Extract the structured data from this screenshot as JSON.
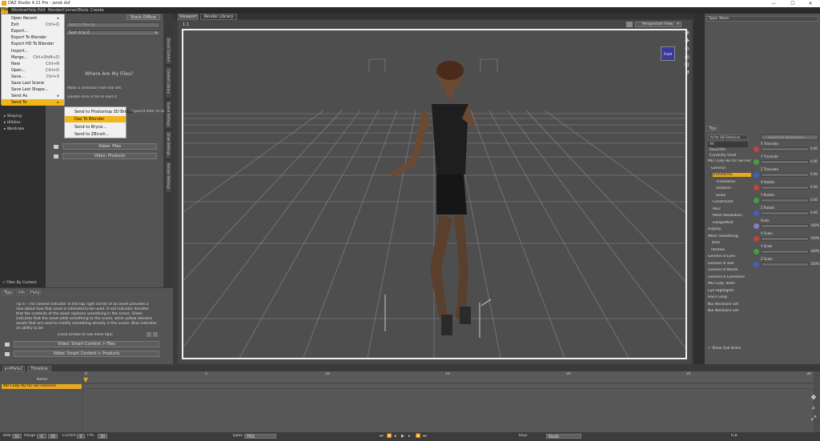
{
  "titlebar": {
    "title": "DAZ Studio 4.21 Pro - janet.duf",
    "min": "—",
    "max": "☐",
    "close": "✕"
  },
  "menubar": [
    "File",
    "Window",
    "Help",
    "Edit",
    "Render",
    "Connect",
    "Tools",
    "Create"
  ],
  "file_menu": [
    {
      "label": "Open Recent",
      "sc": "▸"
    },
    {
      "label": "Exit",
      "sc": "Ctrl+Q"
    },
    {
      "label": "Export...",
      "sc": ""
    },
    {
      "label": "Export To Blender",
      "sc": ""
    },
    {
      "label": "Export HD To Blender",
      "sc": ""
    },
    {
      "label": "Import...",
      "sc": ""
    },
    {
      "label": "Merge...",
      "sc": "Ctrl+Shift+O"
    },
    {
      "label": "New",
      "sc": "Ctrl+N"
    },
    {
      "label": "Open...",
      "sc": "Ctrl+O"
    },
    {
      "label": "Save...",
      "sc": "Ctrl+S"
    },
    {
      "label": "Save Last Scene",
      "sc": ""
    },
    {
      "label": "Save Last Shape...",
      "sc": ""
    },
    {
      "label": "Send As",
      "sc": "▸"
    },
    {
      "label": "Send To",
      "sc": "▸"
    }
  ],
  "send_to_menu": [
    "Send to Photoshop 3D Bridge",
    "Daz To Blender",
    "Send to Bryce...",
    "Send to ZBrush..."
  ],
  "left_panel": {
    "header_right": "Stock Offline",
    "search_placeholder": "Search files by",
    "sort": "Sort: A to Z",
    "wherefiles_title": "Where Are My Files?",
    "line1": "Make a selection from the left.",
    "line2": "Double-click a file to load it.",
    "line3": "...keyword filter to see",
    "tree": [
      "Shaping",
      "Utilities",
      "Wardrobe"
    ],
    "video_files": "Video: Files",
    "video_products": "Video: Products",
    "filter_by_context": "Filter By Context",
    "vtabs": [
      "Smart Content",
      "Content Library",
      "Scene Settings",
      "Draw Settings",
      "Render Settings"
    ]
  },
  "tips": {
    "tabs": [
      "Tips",
      "Info",
      "Help"
    ],
    "text": "Tip 4 - The colored indicator in the top right corner of an asset provides a clue about how that asset is intended to be used. A red indicator denotes that the contents of the asset replaces something in the scene. Green indicates that the asset adds something to the scene, while yellow denotes assets that are used to modify something already in the scene. Blue indicates an ability to be",
    "more": "(Click arrows to see more tips)",
    "btn1": "Video: Smart Content > Files",
    "btn2": "Video: Smart Content > Products"
  },
  "viewport": {
    "tabs": [
      "Viewport",
      "Render Library"
    ],
    "zoom": "1:1",
    "view": "Perspective View",
    "camera_label": "Front"
  },
  "right_top": {
    "type_label": "Type: None"
  },
  "parameters": {
    "tab": "Tips",
    "search_placeholder": "Search for Parameters...",
    "figure": "AI for G8 Feminine",
    "cats": [
      "All",
      "Favorites",
      "Currently Used"
    ],
    "tree": [
      "MO Cody HD for G8 Feminine",
      "General",
      "Transforms",
      "Translation",
      "Rotation",
      "Scale",
      "Constraints",
      "Misc",
      "Mesh Resolution",
      "Geografted",
      "Display",
      "Mesh Smoothing",
      "Tools",
      "Utilities",
      "Genesis 8 Eyes",
      "Genesis 8 Tear",
      "Genesis 8 Mouth",
      "Genesis 8 Eyelashes",
      "MO Cody Teeth",
      "Eye Highlights",
      "Hairs Long",
      "Nui Necklace Set",
      "Nui Necklace Set"
    ],
    "params": [
      {
        "name": "X Translate",
        "val": "0.00"
      },
      {
        "name": "Y Translate",
        "val": "0.00"
      },
      {
        "name": "Z Translate",
        "val": "0.00"
      },
      {
        "name": "X Rotate",
        "val": "0.00"
      },
      {
        "name": "Y Rotate",
        "val": "0.00"
      },
      {
        "name": "Z Rotate",
        "val": "0.00"
      },
      {
        "name": "Scale",
        "val": "100%"
      },
      {
        "name": "X Scale",
        "val": "100%"
      },
      {
        "name": "Y Scale",
        "val": "100%"
      },
      {
        "name": "Z Scale",
        "val": "100%"
      }
    ],
    "show_sub": "Show Sub Items"
  },
  "timeline": {
    "tabs": [
      "aniMate2",
      "Timeline"
    ],
    "name_header": "Name",
    "track": "MO Cody HD for G8 Feminine",
    "ticks": [
      "0",
      "5",
      "10",
      "15",
      "20",
      "25",
      "30"
    ]
  },
  "status": {
    "total_label": "Total",
    "total": "31",
    "range_label": "Range",
    "range_a": "0",
    "range_b": "30",
    "current_label": "Current",
    "current": "0",
    "fps_label": "FPS",
    "fps": "30",
    "types_label": "Types",
    "types": "TRS",
    "keys_label": "Keys",
    "keys": "Node",
    "tcb": "TCB"
  }
}
